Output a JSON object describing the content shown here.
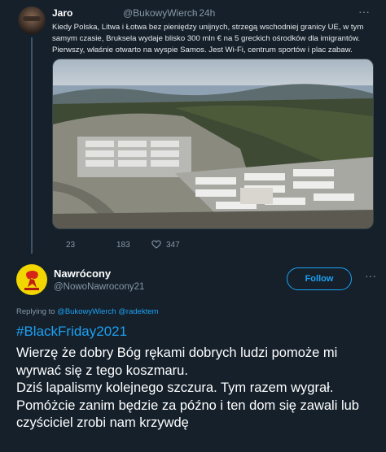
{
  "parent": {
    "name": "Jaro",
    "handle": "@BukowyWierch",
    "time": "· 24h",
    "text": "Kiedy Polska, Litwa i Łotwa bez pieniędzy unijnych, strzegą wschodniej granicy UE, w tym samym  czasie, Bruksela wydaje blisko 300 mln € na 5 greckich ośrodków dla imigrantów. Pierwszy, właśnie otwarto na wyspie Samos. Jest Wi-Fi, centrum sportów i plac zabaw.",
    "actions": {
      "reply_count": "23",
      "retweet_count": "183",
      "like_count": "347",
      "reply_icon": "",
      "retweet_icon": "",
      "like_icon": ""
    }
  },
  "reply": {
    "name": "Nawrócony",
    "handle": "@NowoNawrocony21",
    "follow_label": "Follow",
    "replying_prefix": "Replying to",
    "replying_to_1": "@BukowyWierch",
    "replying_to_2": "@radektem",
    "hashtag": "#BlackFriday2021",
    "line1": "Wierzę że dobry Bóg rękami dobrych ludzi pomoże mi wyrwać się z tego koszmaru.",
    "line2": "Dziś lapalismy kolejnego szczura. Tym razem wygrał.",
    "line3": "Pomóżcie zanim będzie za późno i ten dom się zawali lub czyściciel zrobi nam krzywdę"
  },
  "colors": {
    "background": "#15202b",
    "accent": "#1da1f2",
    "muted": "#8899a6"
  },
  "icons": {
    "more": "ellipsis-icon",
    "reply": "reply-icon",
    "retweet": "retweet-icon",
    "like": "heart-icon"
  }
}
